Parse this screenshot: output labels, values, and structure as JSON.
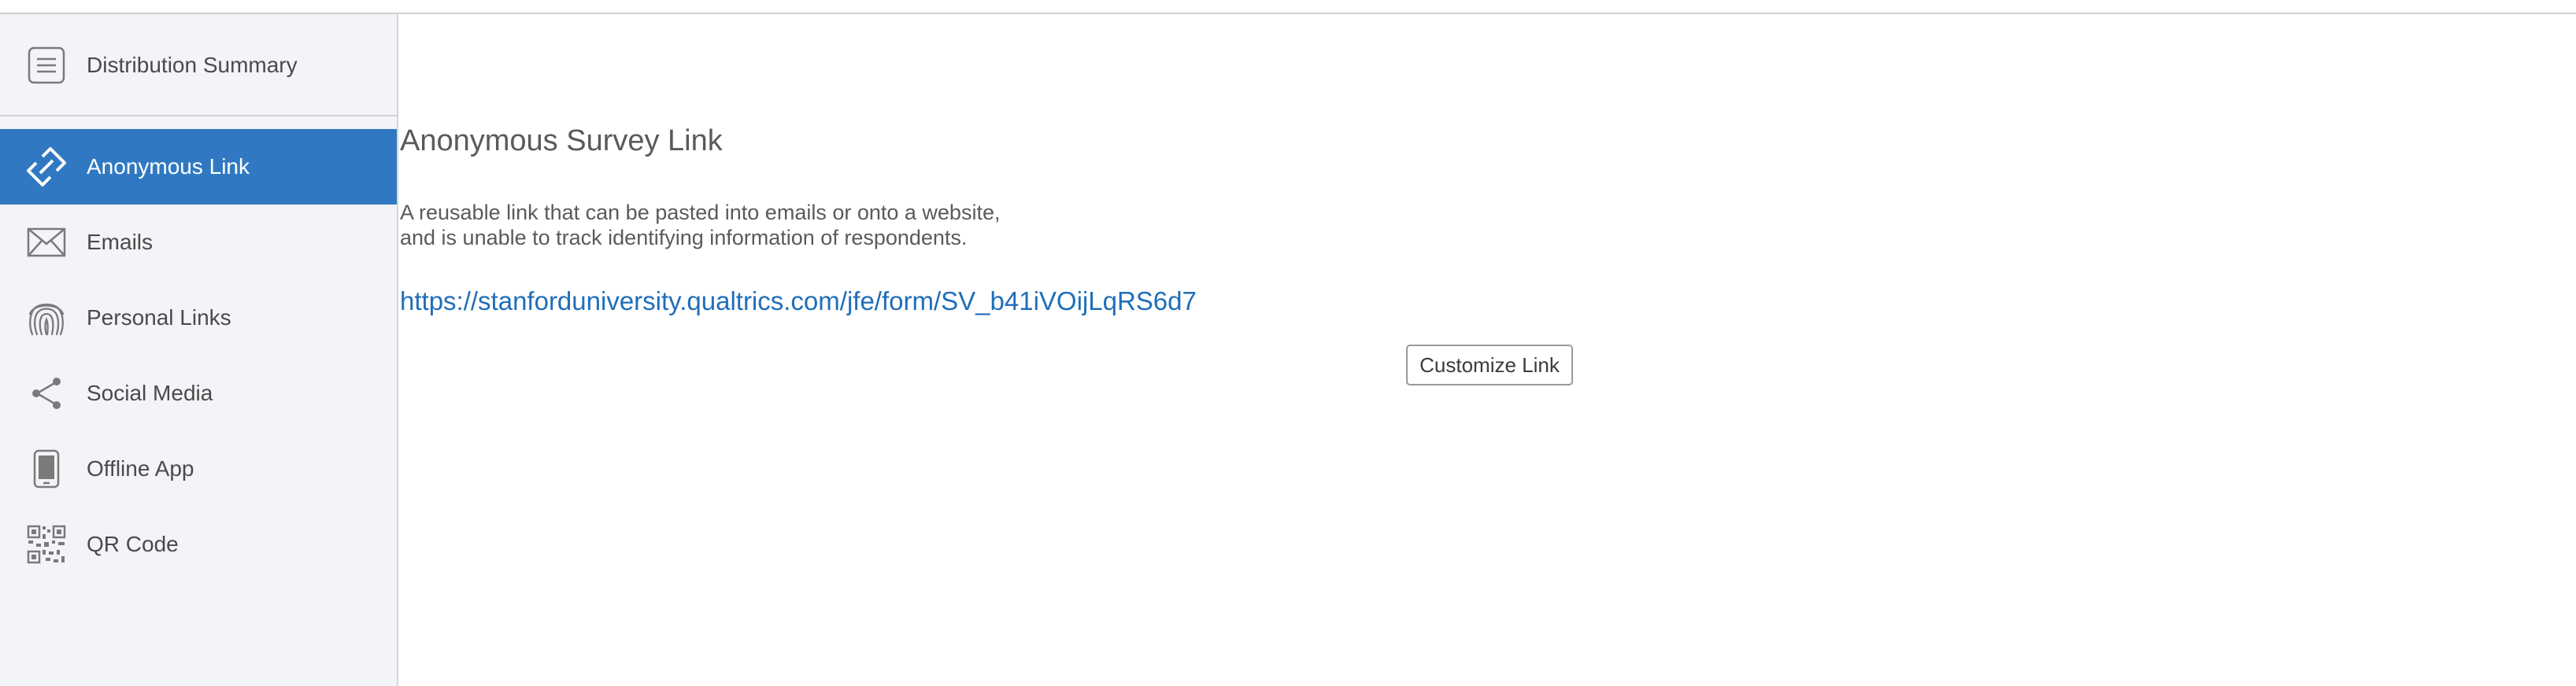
{
  "sidebar": {
    "summary": {
      "label": "Distribution Summary",
      "icon": "document-lines-icon"
    },
    "items": [
      {
        "label": "Anonymous Link",
        "icon": "link-icon",
        "active": true
      },
      {
        "label": "Emails",
        "icon": "envelope-icon",
        "active": false
      },
      {
        "label": "Personal Links",
        "icon": "fingerprint-icon",
        "active": false
      },
      {
        "label": "Social Media",
        "icon": "share-icon",
        "active": false
      },
      {
        "label": "Offline App",
        "icon": "mobile-phone-icon",
        "active": false
      },
      {
        "label": "QR Code",
        "icon": "qr-code-icon",
        "active": false
      }
    ]
  },
  "main": {
    "title": "Anonymous Survey Link",
    "description_line1": "A reusable link that can be pasted into emails or onto a website,",
    "description_line2": "and is unable to track identifying information of respondents.",
    "survey_link": "https://stanforduniversity.qualtrics.com/jfe/form/SV_b41iVOijLqRS6d7",
    "customize_button": "Customize Link"
  },
  "colors": {
    "active_nav_background": "#3079c2",
    "link_color": "#1f6eb9",
    "sidebar_background": "#f3f4f8"
  }
}
